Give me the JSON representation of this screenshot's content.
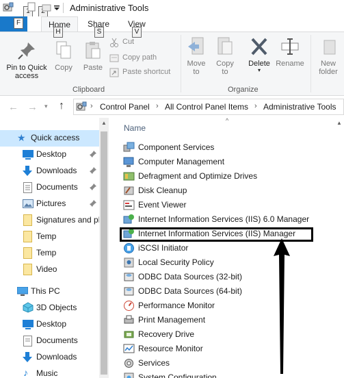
{
  "window": {
    "title": "Administrative Tools"
  },
  "qat": {
    "key_tip_1": "1",
    "key_tip_2": "2"
  },
  "tabs": {
    "file_key": "F",
    "home": "Home",
    "home_key": "H",
    "share": "Share",
    "share_key": "S",
    "view": "View",
    "view_key": "V"
  },
  "ribbon": {
    "pin_to_quick_access": "Pin to Quick\naccess",
    "copy": "Copy",
    "paste": "Paste",
    "cut": "Cut",
    "copy_path": "Copy path",
    "paste_shortcut": "Paste shortcut",
    "clipboard_group": "Clipboard",
    "move_to": "Move\nto",
    "copy_to": "Copy\nto",
    "delete": "Delete",
    "rename": "Rename",
    "organize_group": "Organize",
    "new_folder": "New\nfolder"
  },
  "address": {
    "crumbs": [
      "Control Panel",
      "All Control Panel Items",
      "Administrative Tools"
    ]
  },
  "nav": {
    "items": [
      {
        "label": "Quick access",
        "icon": "star-icon",
        "pinned": false,
        "selected": true
      },
      {
        "label": "Desktop",
        "icon": "desktop-icon",
        "pinned": true
      },
      {
        "label": "Downloads",
        "icon": "download-icon",
        "pinned": true
      },
      {
        "label": "Documents",
        "icon": "documents-icon",
        "pinned": true
      },
      {
        "label": "Pictures",
        "icon": "pictures-icon",
        "pinned": true
      },
      {
        "label": "Signatures and pl",
        "icon": "folder-icon",
        "pinned": false
      },
      {
        "label": "Temp",
        "icon": "folder-icon",
        "pinned": false
      },
      {
        "label": "Temp",
        "icon": "folder-icon",
        "pinned": false
      },
      {
        "label": "Video",
        "icon": "folder-icon",
        "pinned": false
      },
      {
        "label": "This PC",
        "icon": "pc-icon",
        "pinned": false
      },
      {
        "label": "3D Objects",
        "icon": "3d-objects-icon",
        "pinned": false
      },
      {
        "label": "Desktop",
        "icon": "desktop-icon",
        "pinned": false
      },
      {
        "label": "Documents",
        "icon": "documents-icon",
        "pinned": false
      },
      {
        "label": "Downloads",
        "icon": "download-icon",
        "pinned": false
      },
      {
        "label": "Music",
        "icon": "music-icon",
        "pinned": false
      }
    ]
  },
  "content": {
    "column_header": "Name",
    "items": [
      "Component Services",
      "Computer Management",
      "Defragment and Optimize Drives",
      "Disk Cleanup",
      "Event Viewer",
      "Internet Information Services (IIS) 6.0 Manager",
      "Internet Information Services (IIS) Manager",
      "iSCSI Initiator",
      "Local Security Policy",
      "ODBC Data Sources (32-bit)",
      "ODBC Data Sources (64-bit)",
      "Performance Monitor",
      "Print Management",
      "Recovery Drive",
      "Resource Monitor",
      "Services",
      "System Configuration"
    ],
    "highlighted_item": "Internet Information Services (IIS) Manager"
  },
  "colors": {
    "accent": "#1979ca",
    "selected_bg": "#cce8ff",
    "highlight_border": "#000000"
  }
}
